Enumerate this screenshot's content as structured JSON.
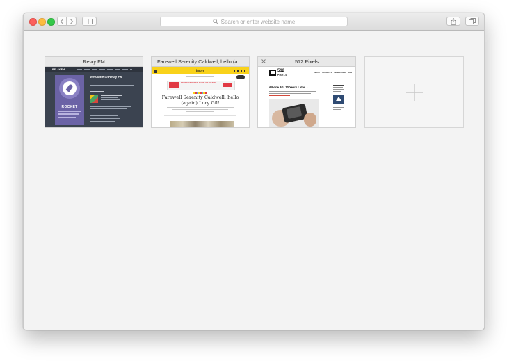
{
  "address_bar": {
    "placeholder": "Search or enter website name"
  },
  "tabs": [
    {
      "title": "Relay FM",
      "page": {
        "logo": "RELAY FM",
        "heading": "Welcome to Relay FM",
        "show_title": "ROCKET"
      }
    },
    {
      "title": "Farewell Serenity Caldwell, hello (again) Lory Gil!",
      "page": {
        "logo": "iMore",
        "banner": "STUDENT OFFER SAVE UP TO 50%",
        "headline": "Farewell Serenity Caldwell, hello (again) Lory Gil!"
      }
    },
    {
      "title": "512 Pixels",
      "page": {
        "logo_top": "512",
        "logo_bottom": "PIXELS",
        "nav": [
          "ABOUT",
          "PROJECTS",
          "MEMBERSHIP",
          "RSS"
        ],
        "headline": "iPhone 3G: 10 Years Later →"
      }
    }
  ],
  "colors": {
    "relay_bg": "#3b4350",
    "relay_purple": "#6b63a6",
    "imore_yellow": "#f9d21a",
    "imore_red": "#e13a44"
  },
  "icons": {
    "new_tab": "plus-icon",
    "share": "share-icon",
    "tabs_overview": "tabs-icon",
    "sidebar": "sidebar-icon",
    "back": "chevron-left-icon",
    "forward": "chevron-right-icon",
    "search": "magnifier-icon",
    "close_tab": "close-icon"
  }
}
